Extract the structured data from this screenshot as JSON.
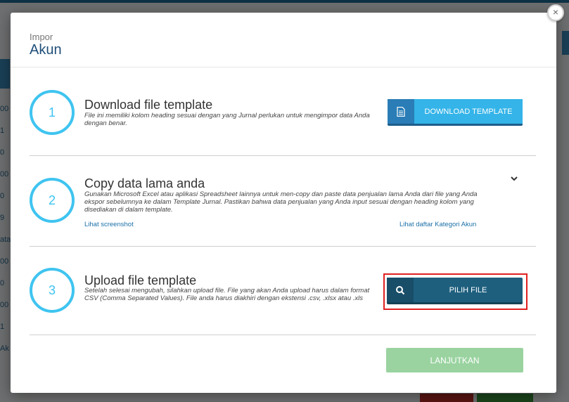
{
  "background": {
    "numbers": [
      "00",
      "1",
      "0",
      "00",
      "0",
      "9",
      "ata",
      "00",
      "0",
      "00",
      "1",
      "Ak"
    ]
  },
  "modal": {
    "subtitle": "Impor",
    "title": "Akun",
    "close_symbol": "×"
  },
  "steps": [
    {
      "number": "1",
      "title": "Download file template",
      "description": "File ini memiliki kolom heading sesuai dengan yang Jurnal perlukan untuk mengimpor data Anda dengan benar.",
      "button_label": "DOWNLOAD TEMPLATE",
      "button_icon": "document-icon"
    },
    {
      "number": "2",
      "title": "Copy data lama anda",
      "description": "Gunakan Microsoft Excel atau aplikasi Spreadsheet lainnya untuk men-copy dan paste data penjualan lama Anda dari file yang Anda ekspor sebelumnya ke dalam Template Jurnal. Pastikan bahwa data penjualan yang Anda input sesuai dengan heading kolom yang disediakan di dalam template.",
      "link_left": "Lihat screenshot",
      "link_right": "Lihat daftar Kategori Akun"
    },
    {
      "number": "3",
      "title": "Upload file template",
      "description": "Setelah selesai mengubah, silahkan upload file. File yang akan Anda upload harus dalam format CSV (Comma Separated Values). File anda harus diakhiri dengan ekstensi .csv, .xlsx atau .xls",
      "button_label": "PILIH FILE",
      "button_icon": "search-icon"
    }
  ],
  "footer": {
    "continue_label": "LANJUTKAN"
  },
  "colors": {
    "accent": "#3fc4f0",
    "title": "#1f4e79",
    "highlight": "#e02020",
    "continue": "#9ad3a0"
  }
}
